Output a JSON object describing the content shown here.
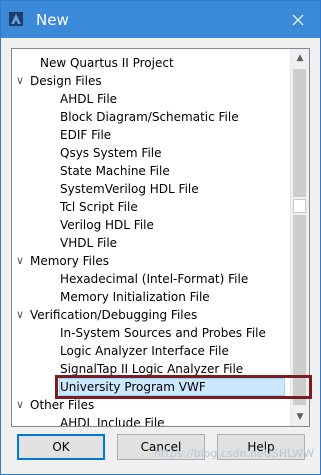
{
  "window": {
    "title": "New",
    "close_icon": "close-icon",
    "app_icon": "quartus-icon"
  },
  "tree": {
    "items": [
      {
        "label": "New Quartus II Project",
        "level": 1,
        "caret": ""
      },
      {
        "label": "Design Files",
        "level": 0,
        "caret": "∨"
      },
      {
        "label": "AHDL File",
        "level": 2,
        "caret": ""
      },
      {
        "label": "Block Diagram/Schematic File",
        "level": 2,
        "caret": ""
      },
      {
        "label": "EDIF File",
        "level": 2,
        "caret": ""
      },
      {
        "label": "Qsys System File",
        "level": 2,
        "caret": ""
      },
      {
        "label": "State Machine File",
        "level": 2,
        "caret": ""
      },
      {
        "label": "SystemVerilog HDL File",
        "level": 2,
        "caret": ""
      },
      {
        "label": "Tcl Script File",
        "level": 2,
        "caret": ""
      },
      {
        "label": "Verilog HDL File",
        "level": 2,
        "caret": ""
      },
      {
        "label": "VHDL File",
        "level": 2,
        "caret": ""
      },
      {
        "label": "Memory Files",
        "level": 0,
        "caret": "∨"
      },
      {
        "label": "Hexadecimal (Intel-Format) File",
        "level": 2,
        "caret": ""
      },
      {
        "label": "Memory Initialization File",
        "level": 2,
        "caret": ""
      },
      {
        "label": "Verification/Debugging Files",
        "level": 0,
        "caret": "∨"
      },
      {
        "label": "In-System Sources and Probes File",
        "level": 2,
        "caret": ""
      },
      {
        "label": "Logic Analyzer Interface File",
        "level": 2,
        "caret": ""
      },
      {
        "label": "SignalTap II Logic Analyzer File",
        "level": 2,
        "caret": ""
      },
      {
        "label": "University Program VWF",
        "level": 2,
        "caret": ""
      },
      {
        "label": "Other Files",
        "level": 0,
        "caret": "∨"
      },
      {
        "label": "AHDL Include File",
        "level": 2,
        "caret": ""
      }
    ],
    "selected_index": 18
  },
  "buttons": {
    "ok": "OK",
    "cancel": "Cancel",
    "help": "Help"
  },
  "watermark": "https://blog.csdn.net/SHLWW",
  "colors": {
    "title_bar": "#3b8ad9",
    "selection": "#cce8ff",
    "highlight_box": "#7b1c20"
  }
}
